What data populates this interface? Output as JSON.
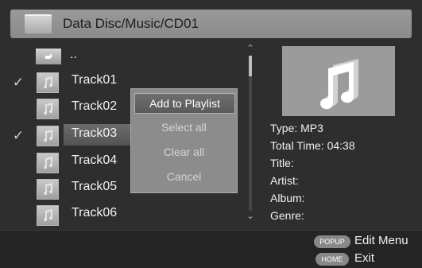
{
  "header": {
    "path": "Data Disc/Music/CD01"
  },
  "file_list": {
    "parent": "..",
    "items": [
      {
        "label": "Track01",
        "checked": true
      },
      {
        "label": "Track02",
        "checked": false
      },
      {
        "label": "Track03",
        "checked": true,
        "highlighted": true
      },
      {
        "label": "Track04",
        "checked": false
      },
      {
        "label": "Track05",
        "checked": false
      },
      {
        "label": "Track06",
        "checked": false
      }
    ],
    "check_glyph": "✓"
  },
  "popup_menu": {
    "items": [
      {
        "label": "Add to Playlist",
        "selected": true
      },
      {
        "label": "Select all",
        "selected": false
      },
      {
        "label": "Clear all",
        "selected": false
      },
      {
        "label": "Cancel",
        "selected": false
      }
    ]
  },
  "scrollbar": {
    "up_glyph": "⌃",
    "down_glyph": "⌄"
  },
  "info_panel": {
    "type": "Type: MP3",
    "total_time": "Total Time: 04:38",
    "title": "Title:",
    "artist": "Artist:",
    "album": "Album:",
    "genre": "Genre:"
  },
  "footer": {
    "popup_key": "POPUP",
    "popup_action": "Edit Menu",
    "home_key": "HOME",
    "home_action": "Exit"
  },
  "icons": {
    "folder": "folder-icon",
    "music_note": "music-note-icon",
    "up_folder": "up-folder-icon",
    "check": "check-icon"
  },
  "colors": {
    "background": "#2e2e2e",
    "titlebar": "#8f8f8f",
    "popup": "#8c8c8c",
    "highlight": "#5e5e5e"
  }
}
